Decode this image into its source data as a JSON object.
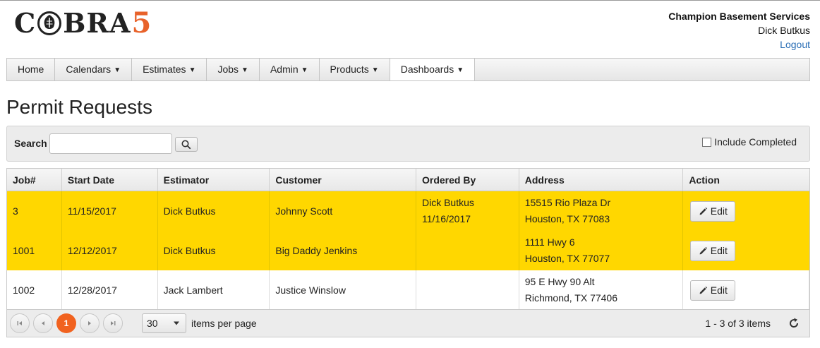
{
  "header": {
    "logo_text": "C",
    "logo_text2": "BRA",
    "logo_num": "5",
    "company": "Champion Basement Services",
    "user": "Dick Butkus",
    "logout": "Logout"
  },
  "nav": {
    "items": [
      {
        "label": "Home",
        "dropdown": false
      },
      {
        "label": "Calendars",
        "dropdown": true
      },
      {
        "label": "Estimates",
        "dropdown": true
      },
      {
        "label": "Jobs",
        "dropdown": true
      },
      {
        "label": "Admin",
        "dropdown": true
      },
      {
        "label": "Products",
        "dropdown": true
      },
      {
        "label": "Dashboards",
        "dropdown": true
      }
    ],
    "caret": "▼"
  },
  "page_title": "Permit Requests",
  "search": {
    "label": "Search",
    "value": "",
    "include_completed_label": "Include Completed",
    "include_completed_checked": false
  },
  "grid": {
    "columns": [
      "Job#",
      "Start Date",
      "Estimator",
      "Customer",
      "Ordered By",
      "Address",
      "Action"
    ],
    "rows": [
      {
        "job": "3",
        "start_date": "11/15/2017",
        "estimator": "Dick Butkus",
        "customer": "Johnny Scott",
        "ordered_by": "Dick Butkus",
        "ordered_date": "11/16/2017",
        "address1": "15515 Rio Plaza Dr",
        "address2": "Houston, TX 77083",
        "action": "Edit",
        "highlight": true
      },
      {
        "job": "1001",
        "start_date": "12/12/2017",
        "estimator": "Dick Butkus",
        "customer": "Big Daddy Jenkins",
        "ordered_by": "",
        "ordered_date": "",
        "address1": "1111 Hwy 6",
        "address2": "Houston, TX 77077",
        "action": "Edit",
        "highlight": true
      },
      {
        "job": "1002",
        "start_date": "12/28/2017",
        "estimator": "Jack Lambert",
        "customer": "Justice Winslow",
        "ordered_by": "",
        "ordered_date": "",
        "address1": "95 E Hwy 90 Alt",
        "address2": "Richmond, TX 77406",
        "action": "Edit",
        "highlight": false
      }
    ]
  },
  "pager": {
    "current_page": "1",
    "per_page": "30",
    "per_page_label": "items per page",
    "info": "1 - 3 of 3 items"
  },
  "colors": {
    "highlight_row": "#ffd700",
    "accent_orange": "#f1621f",
    "link_blue": "#2a6eb5"
  }
}
